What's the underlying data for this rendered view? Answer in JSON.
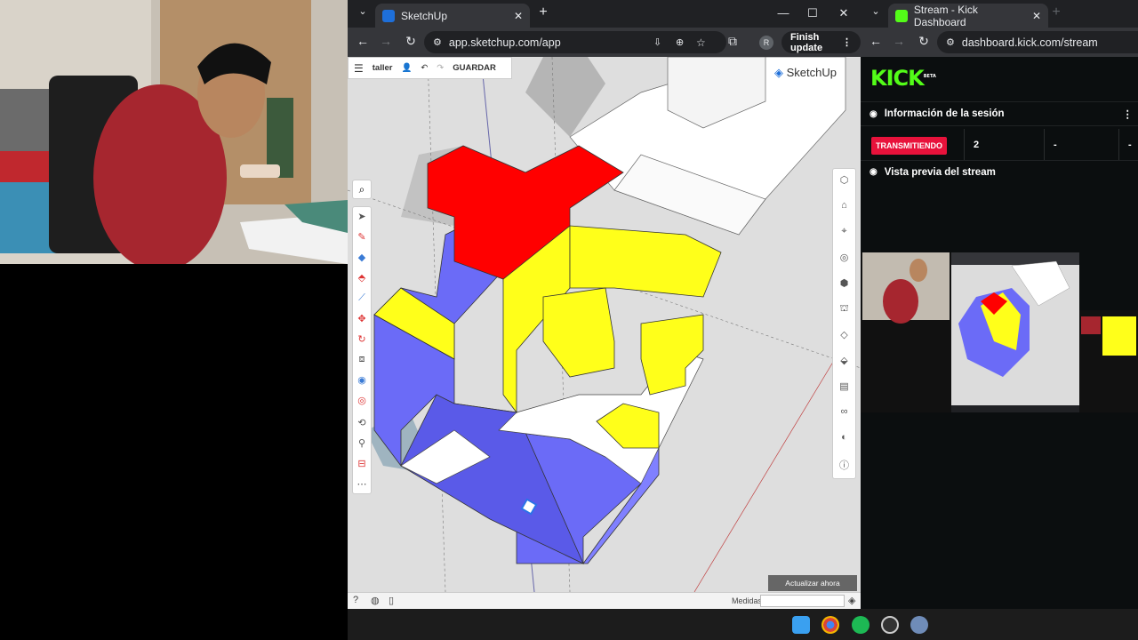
{
  "left_window": {
    "tab_title": "SketchUp",
    "url": "app.sketchup.com/app",
    "finish_update_label": "Finish update",
    "profile_initial": "R"
  },
  "sketchup": {
    "project_name": "taller",
    "save_label": "GUARDAR",
    "brand": "SketchUp",
    "update_button_label": "Actualizar ahora",
    "measurements_label": "Medidas",
    "colors": {
      "red": "#ff0000",
      "yellow": "#ffff00",
      "blue": "#6666ff"
    }
  },
  "right_window": {
    "tab_title": "Stream - Kick Dashboard",
    "url": "dashboard.kick.com/stream",
    "logo": "KICK",
    "logo_badge": "BETA",
    "session_info_title": "Información de la sesión",
    "live_badge": "TRANSMITIENDO",
    "viewers_value": "2",
    "cell_2": "-",
    "cell_3": "-",
    "preview_title": "Vista previa del stream",
    "accent_color": "#53fc18"
  },
  "taskbar": {
    "icons": [
      "windows-start-icon",
      "chrome-icon",
      "spotify-icon",
      "obs-icon",
      "settings-icon"
    ]
  }
}
